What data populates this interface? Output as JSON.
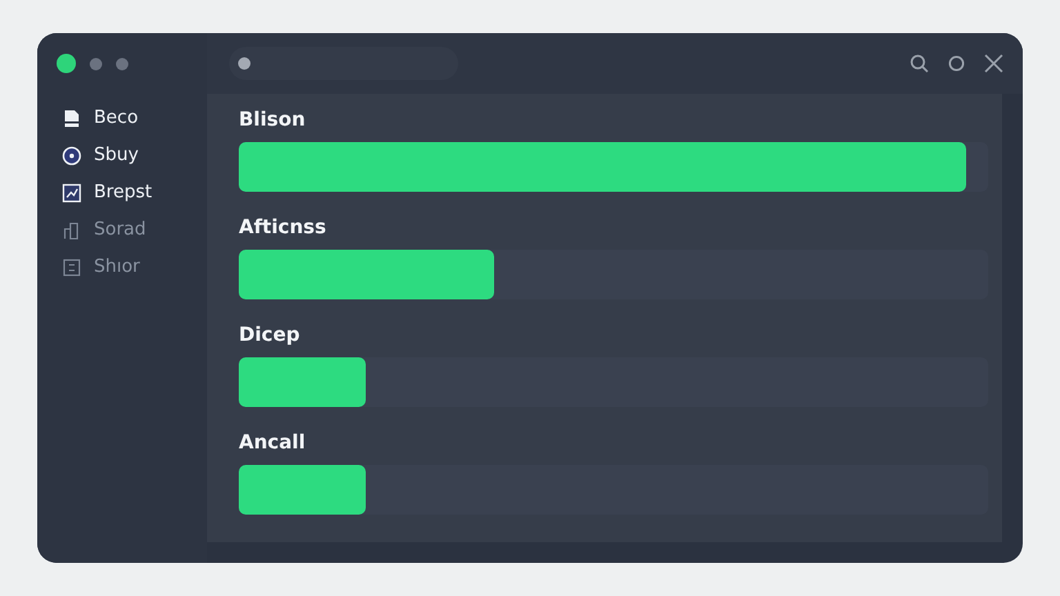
{
  "window": {
    "controls": [
      {
        "color": "#2ed47a"
      },
      {
        "color": "#6b7280"
      },
      {
        "color": "#6b7280"
      }
    ]
  },
  "sidebar": {
    "items": [
      {
        "label": "Beco",
        "kind": "document",
        "disabled": false
      },
      {
        "label": "Sbuy",
        "kind": "compass",
        "disabled": false
      },
      {
        "label": "Brepst",
        "kind": "chart",
        "disabled": false
      },
      {
        "label": "Sorad",
        "kind": "columns",
        "disabled": true
      },
      {
        "label": "Shıor",
        "kind": "card",
        "disabled": true
      }
    ]
  },
  "bars": [
    {
      "label": "Blison",
      "level": 0.97
    },
    {
      "label": "Afticnss",
      "level": 0.34
    },
    {
      "label": "Dicep",
      "level": 0.17
    },
    {
      "label": "Ancall",
      "level": 0.17
    }
  ]
}
